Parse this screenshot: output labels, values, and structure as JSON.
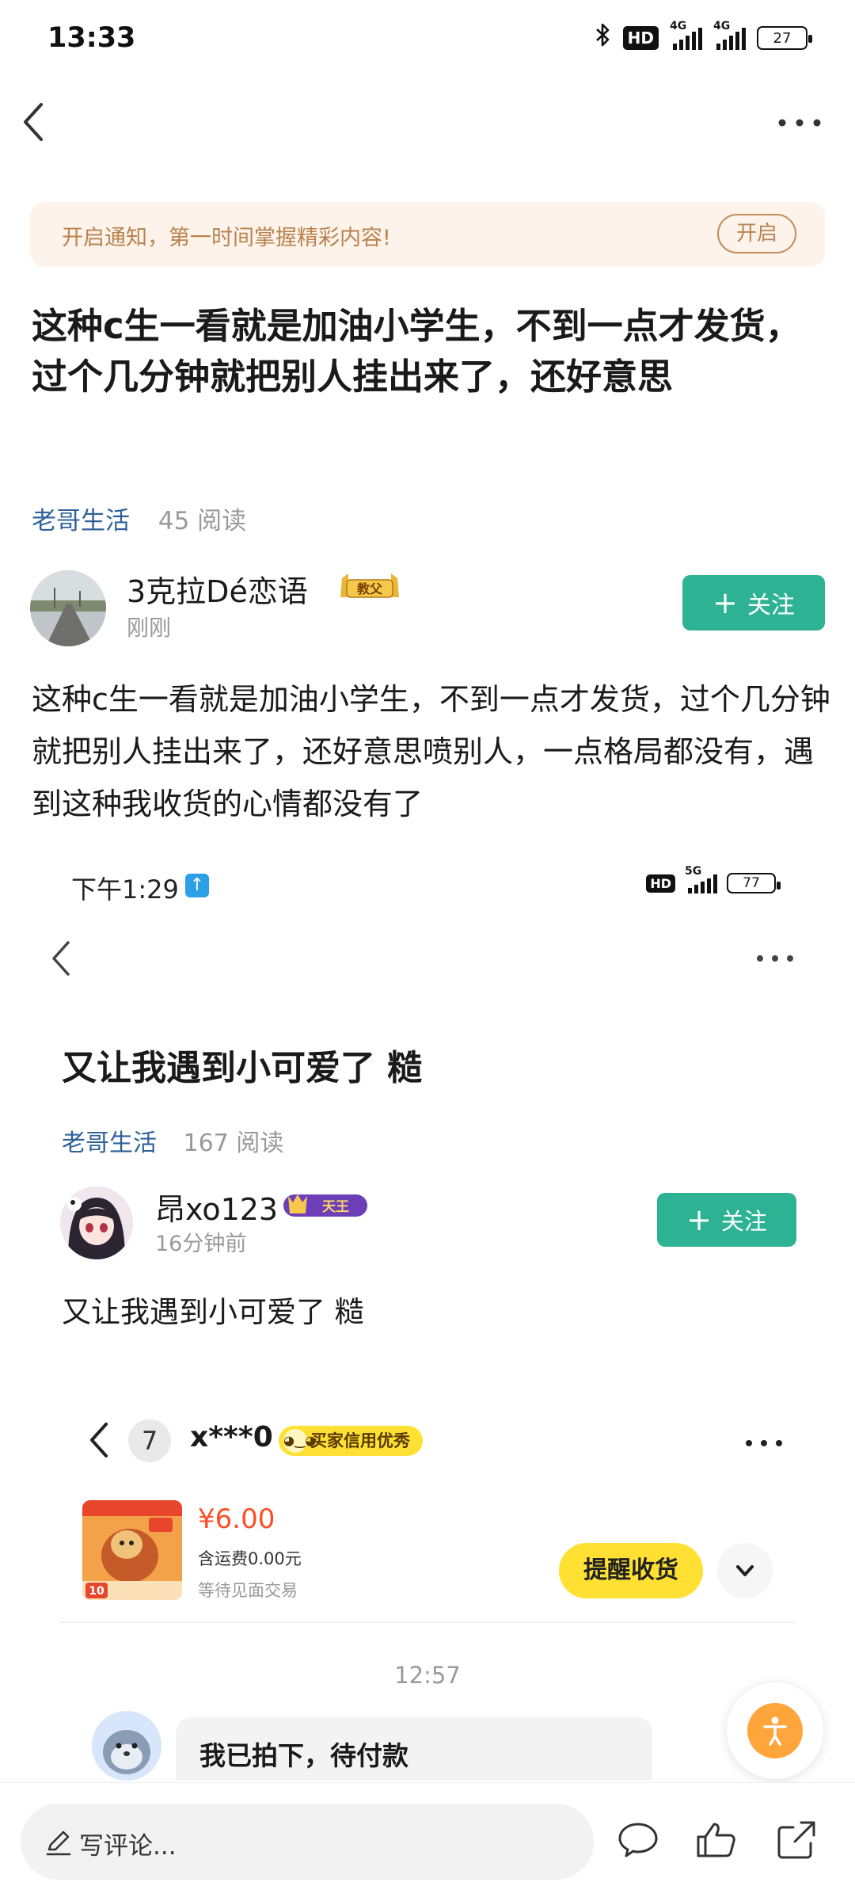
{
  "status_bar": {
    "time": "13:33",
    "hd_label": "HD",
    "signal1": "4G",
    "signal2": "4G",
    "battery": "27"
  },
  "notify_banner": {
    "text": "开启通知，第一时间掌握精彩内容!",
    "button": "开启"
  },
  "post": {
    "title": "这种c生一看就是加油小学生，不到一点才发货，过个几分钟就把别人挂出来了，还好意思",
    "board": "老哥生活",
    "reads": "45 阅读",
    "author_name": "3克拉Dé恋语",
    "author_badge": "教父",
    "author_time": "刚刚",
    "follow_label": "关注",
    "body": "这种c生一看就是加油小学生，不到一点才发货，过个几分钟就把别人挂出来了，还好意思喷别人，一点格局都没有，遇到这种我收货的心情都没有了"
  },
  "embedded_post": {
    "status_time": "下午1:29",
    "status_hd": "HD",
    "status_signal": "5G",
    "status_battery": "77",
    "title": "又让我遇到小可爱了 糙",
    "board": "老哥生活",
    "reads": "167 阅读",
    "author_name": "昂xo123",
    "author_badge": "天王",
    "author_time": "16分钟前",
    "follow_label": "关注",
    "body": "又让我遇到小可爱了 糙"
  },
  "embedded_chat": {
    "unread_count": "7",
    "user": "x***0",
    "credit_badge": "买家信用优秀",
    "price": "¥6.00",
    "shipping": "含运费0.00元",
    "status": "等待见面交易",
    "remind_button": "提醒收货",
    "time": "12:57",
    "message": "我已拍下，待付款",
    "product_tag": "10"
  },
  "bottom_bar": {
    "comment_placeholder": "写评论..."
  },
  "colors": {
    "accent_green": "#2db393",
    "link_blue": "#2f6199",
    "banner_bg": "#fdf3ea",
    "banner_text": "#b9834f",
    "price_red": "#ff4e25",
    "yellow": "#ffe033"
  }
}
